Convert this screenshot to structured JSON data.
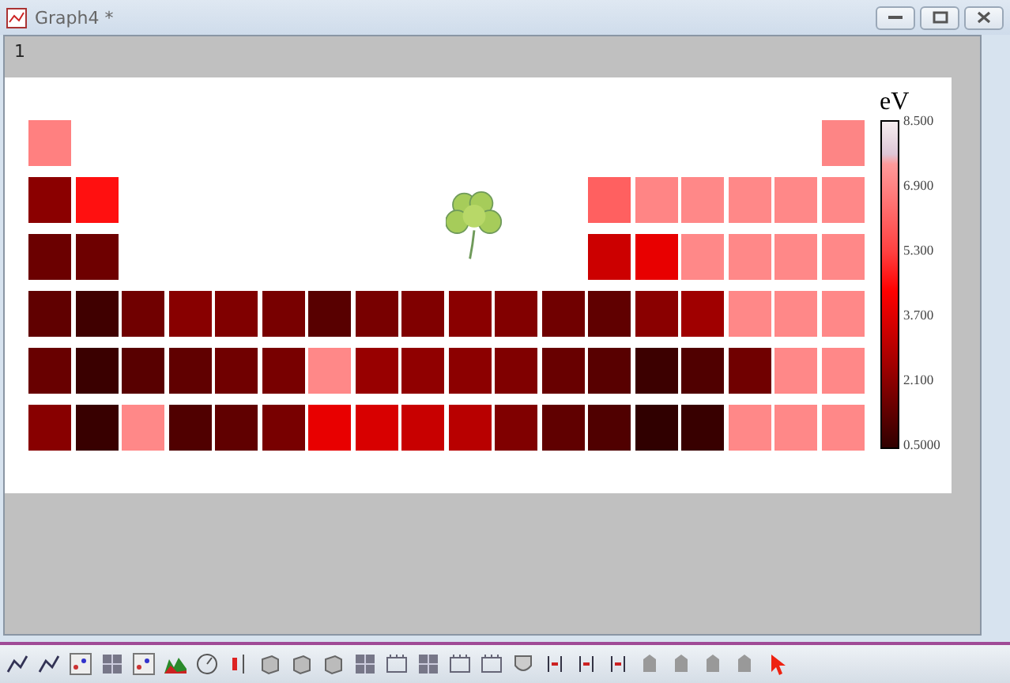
{
  "window": {
    "title": "Graph4 *"
  },
  "layer_label": "1",
  "heatmap": {
    "rows": [
      {
        "left": [
          {
            "color": "#ff8080"
          }
        ],
        "right": [
          {
            "color": "#fd8585"
          }
        ]
      },
      {
        "left": [
          {
            "color": "#8b0000"
          },
          {
            "color": "#ff1010"
          }
        ],
        "right": [
          {
            "color": "#ff6060"
          },
          {
            "color": "#ff8585"
          },
          {
            "color": "#ff8888"
          },
          {
            "color": "#ff8888"
          },
          {
            "color": "#ff8888"
          },
          {
            "color": "#ff8888"
          }
        ]
      },
      {
        "left": [
          {
            "color": "#6b0000"
          },
          {
            "color": "#6e0000"
          }
        ],
        "right": [
          {
            "color": "#cc0000"
          },
          {
            "color": "#e80000"
          },
          {
            "color": "#ff8888"
          },
          {
            "color": "#ff8888"
          },
          {
            "color": "#ff8888"
          },
          {
            "color": "#ff8888"
          }
        ]
      },
      {
        "left": [
          {
            "color": "#600000"
          },
          {
            "color": "#400000"
          },
          {
            "color": "#700000"
          },
          {
            "color": "#880000"
          },
          {
            "color": "#800000"
          },
          {
            "color": "#780000"
          },
          {
            "color": "#580000"
          },
          {
            "color": "#780000"
          },
          {
            "color": "#800000"
          },
          {
            "color": "#8a0000"
          },
          {
            "color": "#820000"
          },
          {
            "color": "#700000"
          },
          {
            "color": "#600000"
          },
          {
            "color": "#8a0000"
          },
          {
            "color": "#a00000"
          },
          {
            "color": "#ff8888"
          },
          {
            "color": "#ff8888"
          },
          {
            "color": "#ff8888"
          }
        ]
      },
      {
        "left": [
          {
            "color": "#680000"
          },
          {
            "color": "#3a0000"
          },
          {
            "color": "#580000"
          },
          {
            "color": "#600000"
          },
          {
            "color": "#700000"
          },
          {
            "color": "#780000"
          },
          {
            "color": "#ff8888"
          },
          {
            "color": "#980000"
          },
          {
            "color": "#900000"
          },
          {
            "color": "#8c0000"
          },
          {
            "color": "#800000"
          },
          {
            "color": "#680000"
          },
          {
            "color": "#580000"
          },
          {
            "color": "#3c0000"
          },
          {
            "color": "#500000"
          },
          {
            "color": "#700000"
          },
          {
            "color": "#ff8888"
          },
          {
            "color": "#ff8888"
          }
        ]
      },
      {
        "left": [
          {
            "color": "#880000"
          },
          {
            "color": "#380000"
          },
          {
            "color": "#ff8888"
          },
          {
            "color": "#500000"
          },
          {
            "color": "#600000"
          },
          {
            "color": "#780000"
          },
          {
            "color": "#e80000"
          },
          {
            "color": "#d80000"
          },
          {
            "color": "#c80000"
          },
          {
            "color": "#b80000"
          },
          {
            "color": "#800000"
          },
          {
            "color": "#600000"
          },
          {
            "color": "#500000"
          },
          {
            "color": "#300000"
          },
          {
            "color": "#380000"
          },
          {
            "color": "#ff8888"
          },
          {
            "color": "#ff8888"
          },
          {
            "color": "#ff8888"
          }
        ]
      }
    ]
  },
  "color_scale": {
    "title": "eV",
    "ticks": [
      "8.500",
      "6.900",
      "5.300",
      "3.700",
      "2.100",
      "0.5000"
    ]
  }
}
